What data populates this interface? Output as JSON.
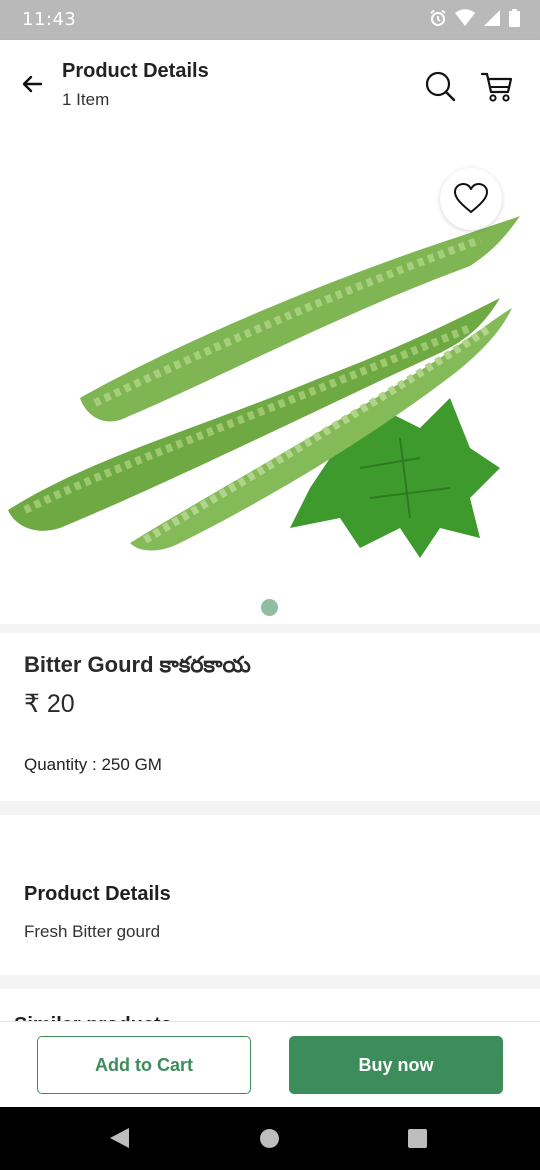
{
  "status_bar": {
    "time": "11:43",
    "icons": [
      "alarm-icon",
      "wifi-icon",
      "signal-icon",
      "battery-icon"
    ]
  },
  "app_bar": {
    "title": "Product Details",
    "subtitle": "1 Item",
    "icons": [
      "back-arrow-icon",
      "search-icon",
      "cart-icon"
    ]
  },
  "product": {
    "image_icon": "favorite-heart-icon",
    "carousel_dots": 1,
    "name": "Bitter Gourd కాకరకాయ",
    "price": "₹ 20",
    "quantity": "Quantity : 250 GM"
  },
  "details": {
    "heading": "Product Details",
    "text": "Fresh Bitter gourd"
  },
  "similar": {
    "heading": "Similar products"
  },
  "actions": {
    "add_to_cart": "Add to Cart",
    "buy_now": "Buy now"
  },
  "colors": {
    "accent": "#3d8c5c",
    "status_bar": "#b9b9b9",
    "dot": "#8fbf9f"
  }
}
